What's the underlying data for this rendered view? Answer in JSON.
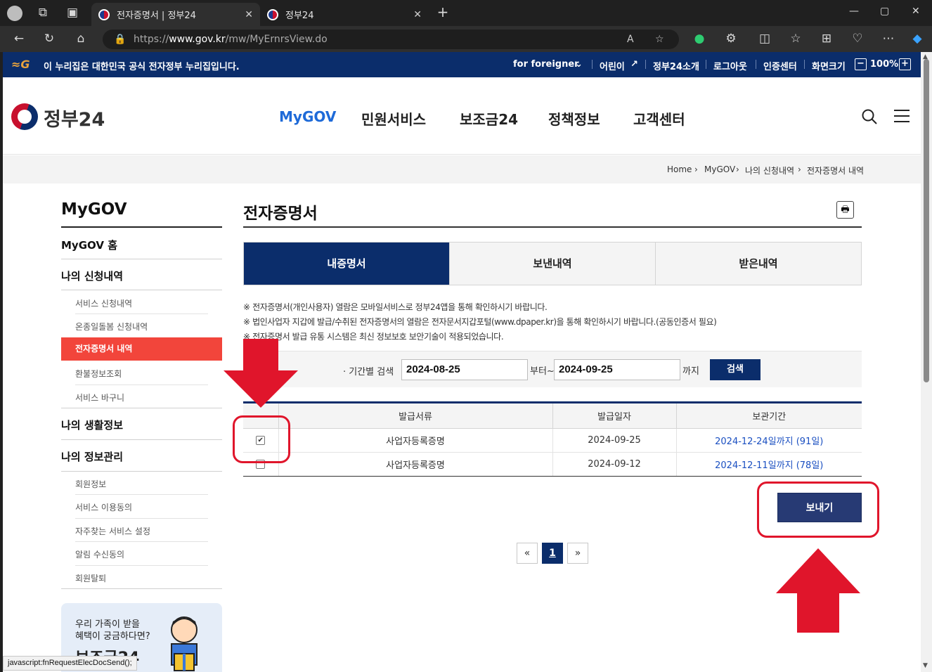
{
  "browser": {
    "tabs": [
      {
        "title": "전자증명서 | 정부24",
        "active": true
      },
      {
        "title": "정부24",
        "active": false
      }
    ],
    "url_prefix": "https://",
    "url_host": "www.gov.kr",
    "url_path": "/mw/MyErnrsView.do",
    "status_text": "javascript:fnRequestElecDocSend();"
  },
  "top_strip": {
    "notice": "이 누리집은 대한민국 공식 전자정부 누리집입니다.",
    "links": [
      "for foreigner",
      "어린이",
      "정부24소개",
      "로그아웃",
      "인증센터",
      "화면크기"
    ],
    "zoom": "100%",
    "zoom_minus": "−",
    "zoom_plus": "+"
  },
  "header": {
    "logo": "정부24",
    "nav": [
      "MyGOV",
      "민원서비스",
      "보조금24",
      "정책정보",
      "고객센터"
    ]
  },
  "breadcrumb": [
    "Home",
    "MyGOV",
    "나의 신청내역",
    "전자증명서 내역"
  ],
  "sidebar": {
    "title": "MyGOV",
    "home": "MyGOV 홈",
    "section1": "나의 신청내역",
    "section1_items": [
      "서비스 신청내역",
      "온종일돌봄 신청내역",
      "전자증명서 내역",
      "환불정보조회",
      "서비스 바구니"
    ],
    "section2": "나의 생활정보",
    "section3": "나의 정보관리",
    "section3_items": [
      "회원정보",
      "서비스 이용동의",
      "자주찾는 서비스 설정",
      "알림 수신동의",
      "회원탈퇴"
    ],
    "banner_line1": "우리 가족이 받을",
    "banner_line2": "혜택이 궁금하다면?",
    "banner_big": "보조금24"
  },
  "main": {
    "title": "전자증명서",
    "tabs": [
      "내증명서",
      "보낸내역",
      "받은내역"
    ],
    "notices": [
      "※ 전자증명서(개인사용자) 열람은 모바일서비스로 정부24앱을 통해 확인하시기 바랍니다.",
      "※ 법인사업자 지갑에 발급/수취된 전자증명서의 열람은 전자문서지갑포털(www.dpaper.kr)을 통해 확인하시기 바랍니다.(공동인증서 필요)",
      "※ 전자증명서 발급 유통 시스템은 최신 정보보호 보안기술이 적용되었습니다."
    ],
    "search": {
      "label": "기간별 검색",
      "from": "2024-08-25",
      "from_suffix": "부터~",
      "to": "2024-09-25",
      "to_suffix": "까지",
      "button": "검색"
    },
    "table": {
      "headers": [
        "",
        "발급서류",
        "발급일자",
        "보관기간"
      ],
      "rows": [
        {
          "checked": true,
          "doc": "사업자등록증명",
          "date": "2024-09-25",
          "period": "2024-12-24일까지 (91일)"
        },
        {
          "checked": false,
          "doc": "사업자등록증명",
          "date": "2024-09-12",
          "period": "2024-12-11일까지 (78일)"
        }
      ]
    },
    "send_button": "보내기",
    "pagination": {
      "prev": "«",
      "current": "1",
      "next": "»"
    }
  }
}
